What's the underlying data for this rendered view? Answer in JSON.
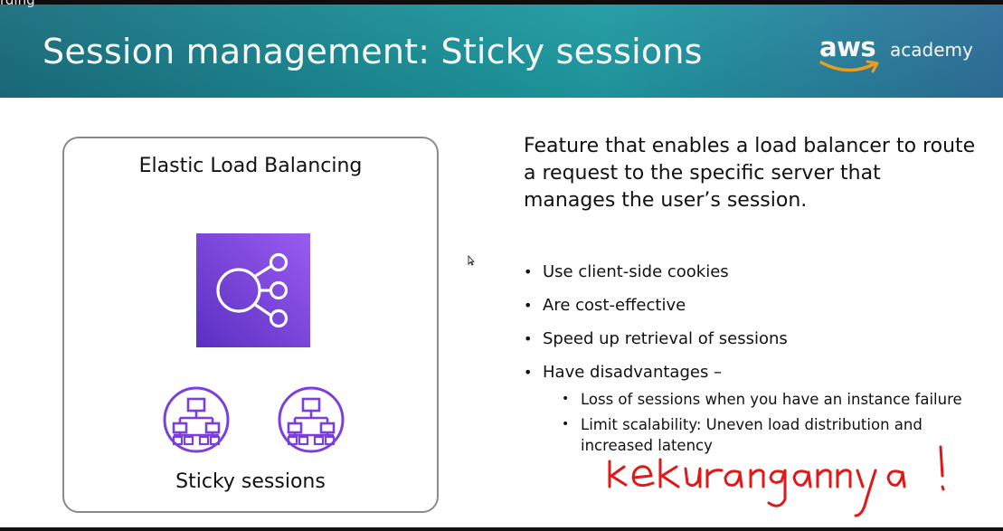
{
  "recording_label": "rding",
  "slide": {
    "title": "Session management: Sticky sessions",
    "logo": {
      "brand": "aws",
      "sub": "academy"
    },
    "diagram": {
      "title": "Elastic Load Balancing",
      "main_icon": "elastic-load-balancing-icon",
      "sticky_icons": [
        "network-hierarchy-icon",
        "network-hierarchy-icon"
      ],
      "label": "Sticky sessions"
    },
    "description": "Feature that enables a load balancer to route a request to the specific server that manages the user’s session.",
    "bullets": [
      "Use client-side cookies",
      "Are cost-effective",
      "Speed up retrieval of sessions",
      "Have disadvantages –"
    ],
    "sub_bullets": [
      "Loss of sessions when you have an instance failure",
      "Limit scalability: Uneven load distribution and increased latency"
    ],
    "handwriting": "kekurangannya !"
  },
  "colors": {
    "header_teal": "#1b8a93",
    "elb_purple": "#7b3fe0",
    "annotation_red": "#e01818"
  }
}
